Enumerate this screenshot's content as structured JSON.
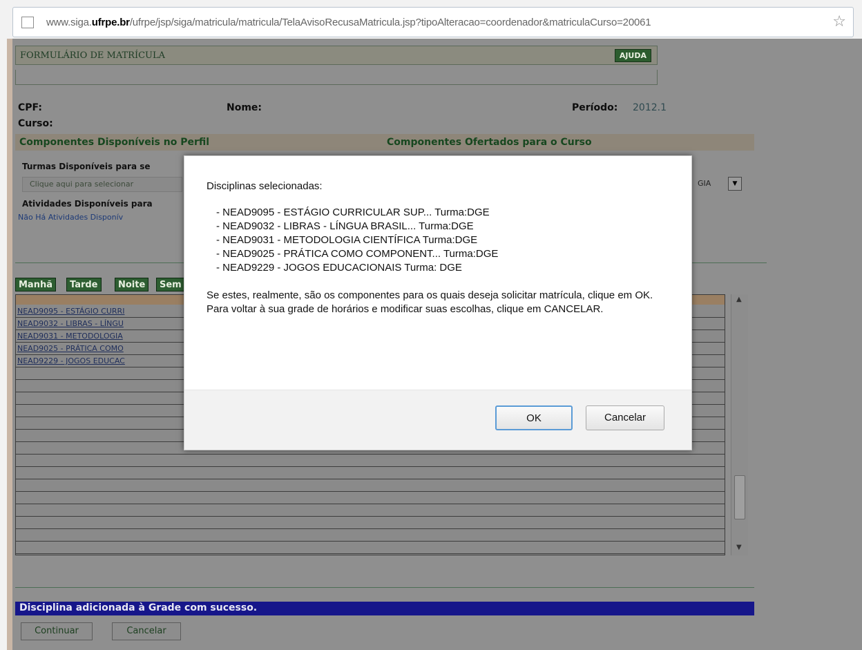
{
  "browser": {
    "url_prefix": "www.siga.",
    "url_domain": "ufrpe.br",
    "url_rest": "/ufrpe/jsp/siga/matricula/matricula/TelaAvisoRecusaMatricula.jsp?tipoAlteracao=coordenador&matriculaCurso=20061"
  },
  "form": {
    "title": "FORMULÁRIO DE MATRÍCULA",
    "help_label": "AJUDA",
    "cpf_label": "CPF:",
    "nome_label": "Nome:",
    "periodo_label": "Período:",
    "periodo_value": "2012.1",
    "curso_label": "Curso:",
    "section_left": "Componentes Disponíveis no Perfil",
    "section_right": "Componentes Ofertados para o Curso",
    "turmas_label": "Turmas Disponíveis para se",
    "select_placeholder": "Clique aqui para selecionar",
    "right_select_value": "GIA",
    "atividades_label": "Atividades Disponíveis para",
    "no_atividades": "Não Há Atividades Disponív",
    "tabs": [
      "Manhã",
      "Tarde",
      "Noite",
      "Sem"
    ],
    "rows": [
      "NEAD9095 - ESTÁGIO CURRI",
      "NEAD9032 - LIBRAS - LÍNGU",
      "NEAD9031 - METODOLOGIA",
      "NEAD9025 - PRÁTICA COMO",
      "NEAD9229 - JOGOS EDUCAC"
    ],
    "success_message": "Disciplina adicionada à Grade com sucesso.",
    "continue_label": "Continuar",
    "cancel_label": "Cancelar"
  },
  "dialog": {
    "heading": "Disciplinas selecionadas:",
    "items": [
      "- NEAD9095 - ESTÁGIO CURRICULAR SUP... Turma:DGE",
      "- NEAD9032 - LIBRAS - LÍNGUA BRASIL... Turma:DGE",
      "- NEAD9031 - METODOLOGIA CIENTÍFICA Turma:DGE",
      "- NEAD9025 - PRÁTICA COMO COMPONENT... Turma:DGE",
      "- NEAD9229 - JOGOS EDUCACIONAIS Turma: DGE"
    ],
    "message_line1": "Se estes, realmente, são os componentes para os quais deseja solicitar matrícula, clique em OK.",
    "message_line2": "Para voltar à sua grade de horários e modificar suas escolhas, clique em CANCELAR.",
    "ok_label": "OK",
    "cancel_label": "Cancelar"
  }
}
